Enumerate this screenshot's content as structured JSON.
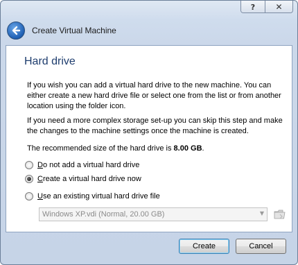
{
  "window": {
    "title": "Create Virtual Machine",
    "help_glyph": "?",
    "close_glyph": "✕"
  },
  "page": {
    "heading": "Hard drive",
    "paragraph1": "If you wish you can add a virtual hard drive to the new machine. You can either create a new hard drive file or select one from the list or from another location using the folder icon.",
    "paragraph2": "If you need a more complex storage set-up you can skip this step and make the changes to the machine settings once the machine is created.",
    "recommended_prefix": "The recommended size of the hard drive is ",
    "recommended_size": "8.00 GB",
    "recommended_suffix": "."
  },
  "options": [
    {
      "mnemonic": "D",
      "rest": "o not add a virtual hard drive",
      "selected": false
    },
    {
      "mnemonic": "C",
      "rest": "reate a virtual hard drive now",
      "selected": true
    },
    {
      "mnemonic": "U",
      "rest": "se an existing virtual hard drive file",
      "selected": false
    }
  ],
  "existing_file": {
    "value": "Windows XP.vdi (Normal, 20.00 GB)",
    "enabled": false
  },
  "buttons": {
    "create": "Create",
    "cancel": "Cancel"
  },
  "colors": {
    "heading": "#1e3d6e",
    "accent": "#1e5fb3"
  },
  "icons": [
    "help-icon",
    "close-icon",
    "back-arrow-icon",
    "dropdown-arrow-icon",
    "folder-icon"
  ]
}
